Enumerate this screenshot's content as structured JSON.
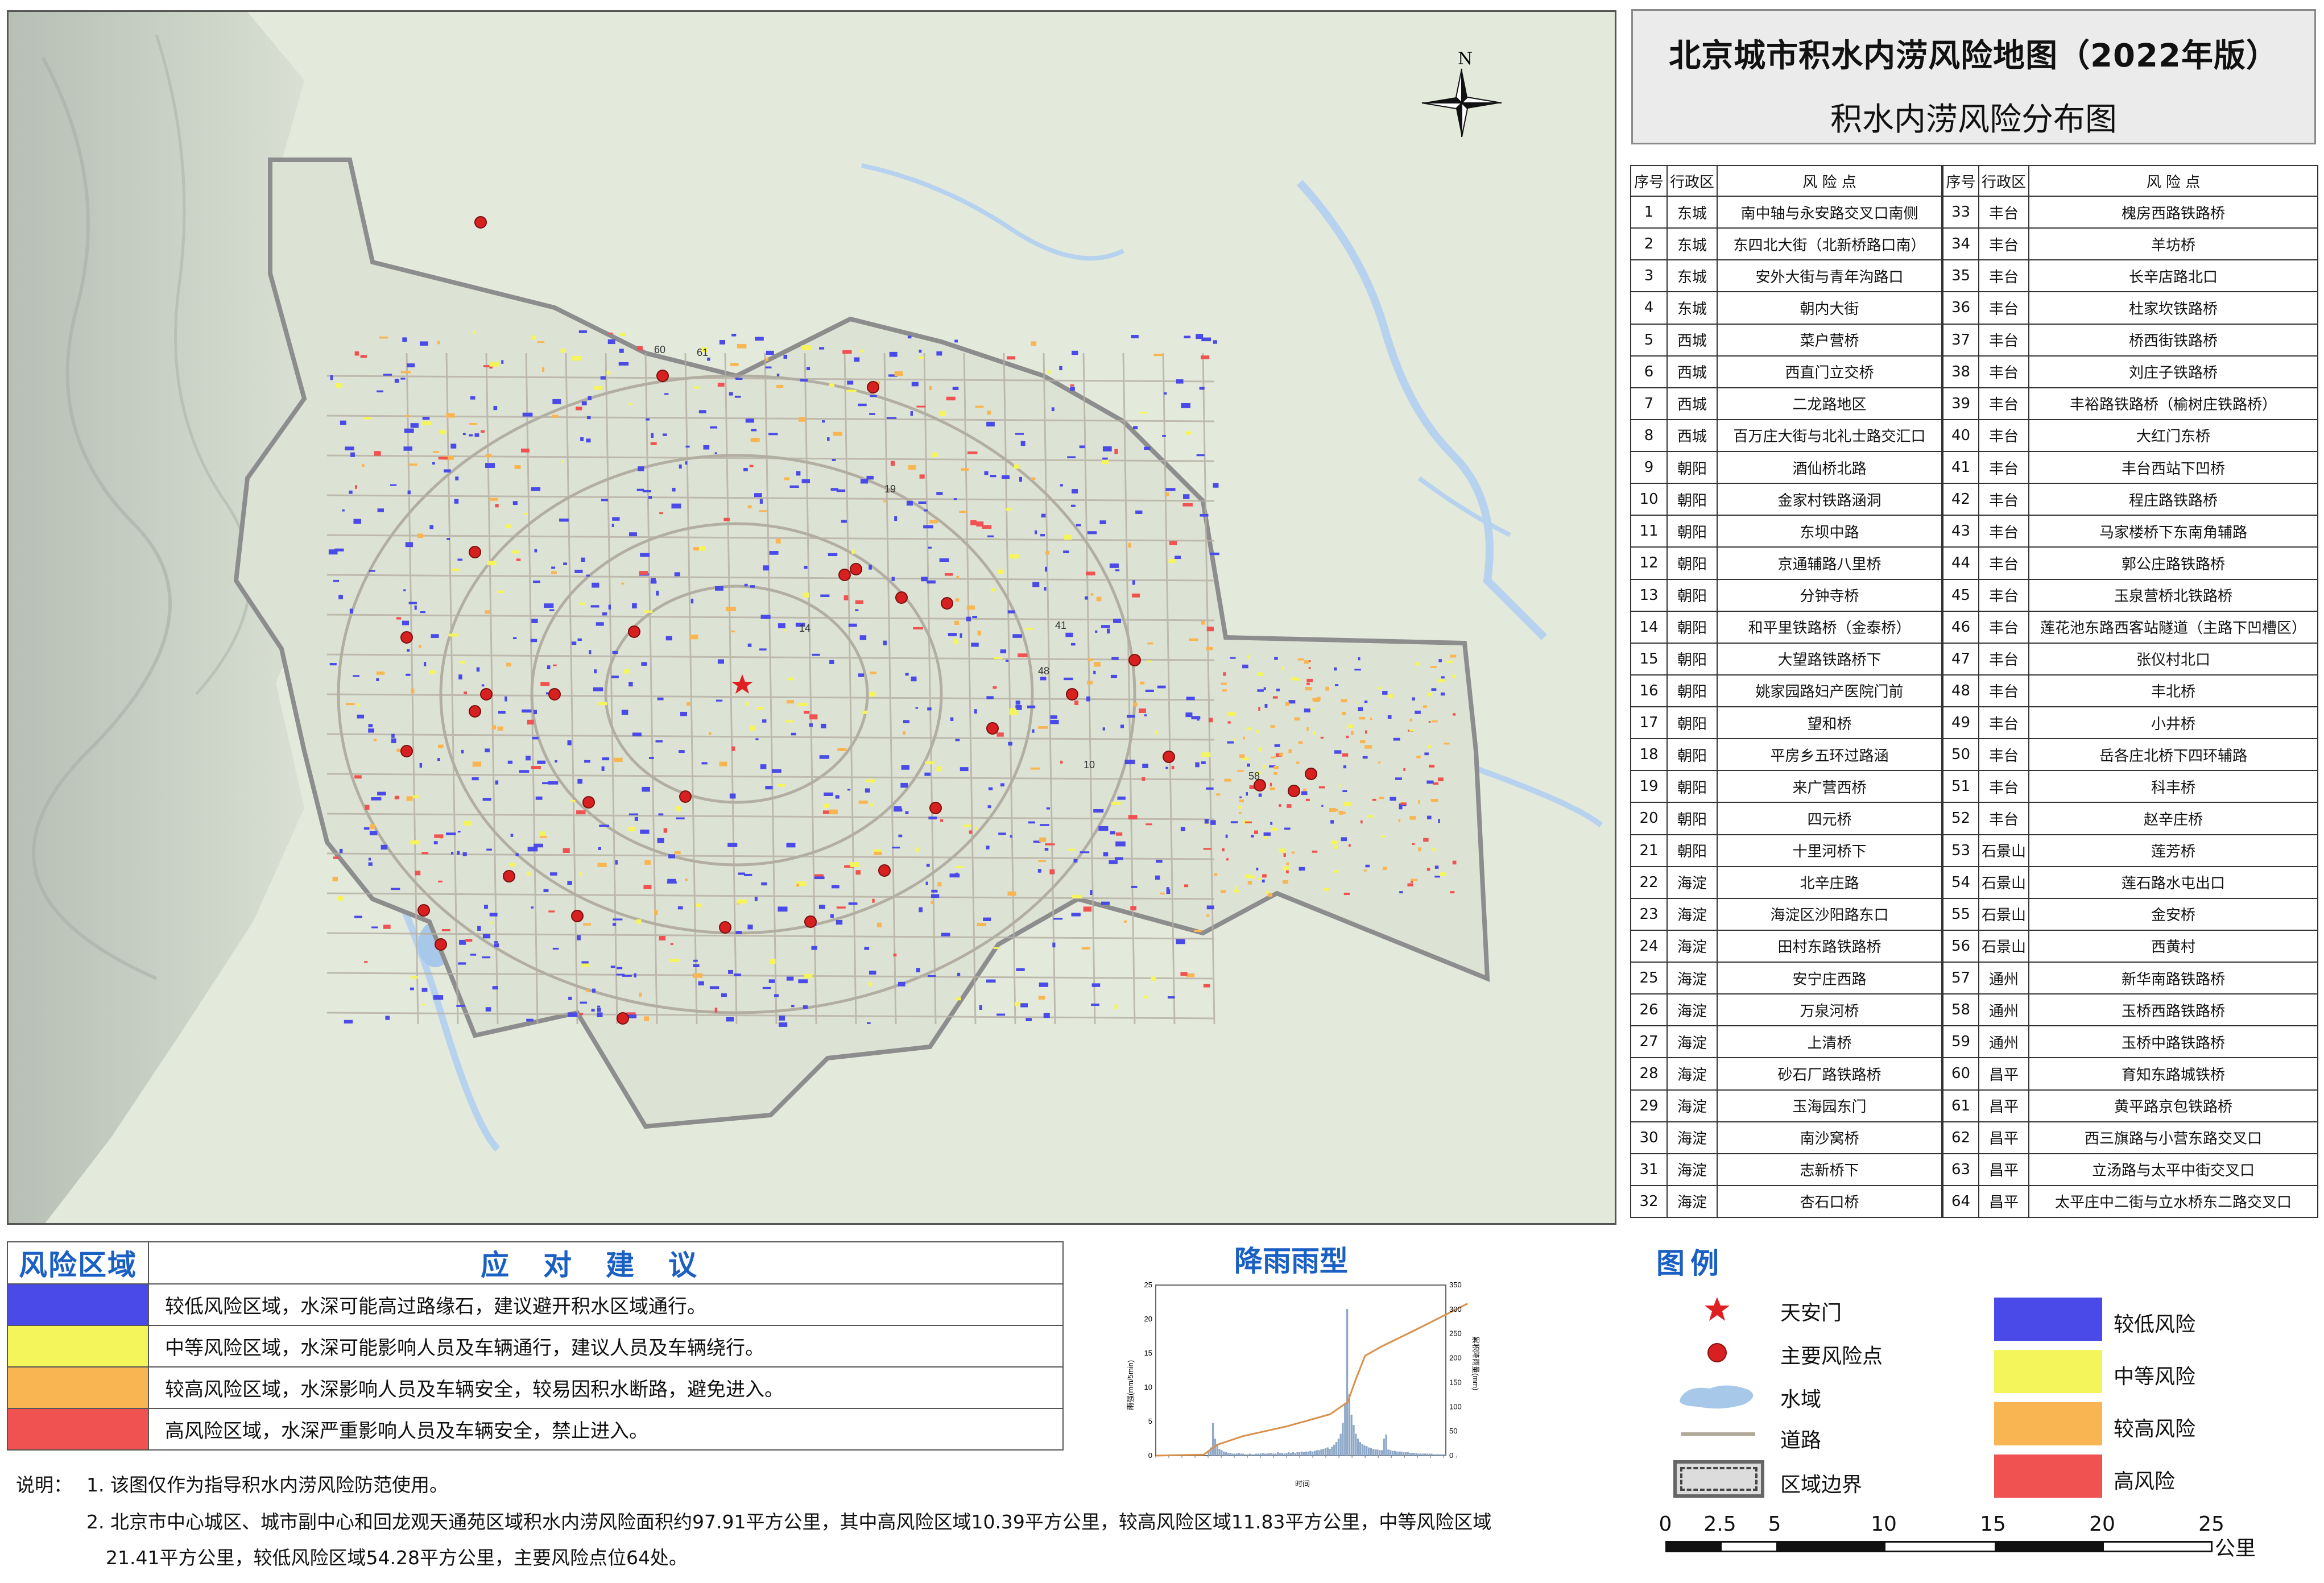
{
  "title": "北京城市积水内涝风险地图（2022年版）",
  "subtitle": "积水内涝风险分布图",
  "compass_label": "N",
  "table": {
    "headers": [
      "序号",
      "行政区",
      "风 险 点",
      "序号",
      "行政区",
      "风 险 点"
    ],
    "rows": [
      [
        "1",
        "东城",
        "南中轴与永安路交叉口南侧",
        "33",
        "丰台",
        "槐房西路铁路桥"
      ],
      [
        "2",
        "东城",
        "东四北大街（北新桥路口南）",
        "34",
        "丰台",
        "羊坊桥"
      ],
      [
        "3",
        "东城",
        "安外大街与青年沟路口",
        "35",
        "丰台",
        "长辛店路北口"
      ],
      [
        "4",
        "东城",
        "朝内大街",
        "36",
        "丰台",
        "杜家坎铁路桥"
      ],
      [
        "5",
        "西城",
        "菜户营桥",
        "37",
        "丰台",
        "桥西街铁路桥"
      ],
      [
        "6",
        "西城",
        "西直门立交桥",
        "38",
        "丰台",
        "刘庄子铁路桥"
      ],
      [
        "7",
        "西城",
        "二龙路地区",
        "39",
        "丰台",
        "丰裕路铁路桥（榆树庄铁路桥）"
      ],
      [
        "8",
        "西城",
        "百万庄大街与北礼士路交汇口",
        "40",
        "丰台",
        "大红门东桥"
      ],
      [
        "9",
        "朝阳",
        "酒仙桥北路",
        "41",
        "丰台",
        "丰台西站下凹桥"
      ],
      [
        "10",
        "朝阳",
        "金家村铁路涵洞",
        "42",
        "丰台",
        "程庄路铁路桥"
      ],
      [
        "11",
        "朝阳",
        "东坝中路",
        "43",
        "丰台",
        "马家楼桥下东南角辅路"
      ],
      [
        "12",
        "朝阳",
        "京通辅路八里桥",
        "44",
        "丰台",
        "郭公庄路铁路桥"
      ],
      [
        "13",
        "朝阳",
        "分钟寺桥",
        "45",
        "丰台",
        "玉泉营桥北铁路桥"
      ],
      [
        "14",
        "朝阳",
        "和平里铁路桥（金泰桥）",
        "46",
        "丰台",
        "莲花池东路西客站隧道（主路下凹槽区）"
      ],
      [
        "15",
        "朝阳",
        "大望路铁路桥下",
        "47",
        "丰台",
        "张仪村北口"
      ],
      [
        "16",
        "朝阳",
        "姚家园路妇产医院门前",
        "48",
        "丰台",
        "丰北桥"
      ],
      [
        "17",
        "朝阳",
        "望和桥",
        "49",
        "丰台",
        "小井桥"
      ],
      [
        "18",
        "朝阳",
        "平房乡五环过路涵",
        "50",
        "丰台",
        "岳各庄北桥下四环辅路"
      ],
      [
        "19",
        "朝阳",
        "来广营西桥",
        "51",
        "丰台",
        "科丰桥"
      ],
      [
        "20",
        "朝阳",
        "四元桥",
        "52",
        "丰台",
        "赵辛庄桥"
      ],
      [
        "21",
        "朝阳",
        "十里河桥下",
        "53",
        "石景山",
        "莲芳桥"
      ],
      [
        "22",
        "海淀",
        "北辛庄路",
        "54",
        "石景山",
        "莲石路水屯出口"
      ],
      [
        "23",
        "海淀",
        "海淀区沙阳路东口",
        "55",
        "石景山",
        "金安桥"
      ],
      [
        "24",
        "海淀",
        "田村东路铁路桥",
        "56",
        "石景山",
        "西黄村"
      ],
      [
        "25",
        "海淀",
        "安宁庄西路",
        "57",
        "通州",
        "新华南路铁路桥"
      ],
      [
        "26",
        "海淀",
        "万泉河桥",
        "58",
        "通州",
        "玉桥西路铁路桥"
      ],
      [
        "27",
        "海淀",
        "上清桥",
        "59",
        "通州",
        "玉桥中路铁路桥"
      ],
      [
        "28",
        "海淀",
        "砂石厂路铁路桥",
        "60",
        "昌平",
        "育知东路城铁桥"
      ],
      [
        "29",
        "海淀",
        "玉海园东门",
        "61",
        "昌平",
        "黄平路京包铁路桥"
      ],
      [
        "30",
        "海淀",
        "南沙窝桥",
        "62",
        "昌平",
        "西三旗路与小营东路交叉口"
      ],
      [
        "31",
        "海淀",
        "志新桥下",
        "63",
        "昌平",
        "立汤路与太平中街交叉口"
      ],
      [
        "32",
        "海淀",
        "杏石口桥",
        "64",
        "昌平",
        "太平庄中二街与立水桥东二路交叉口"
      ]
    ]
  },
  "advice": {
    "header_zone": "风险区域",
    "header_advice": "应对建议",
    "rows": [
      {
        "color": "#4a4ae8",
        "text": "较低风险区域，水深可能高过路缘石，建议避开积水区域通行。"
      },
      {
        "color": "#f4f55a",
        "text": "中等风险区域，水深可能影响人员及车辆通行，建议人员及车辆绕行。"
      },
      {
        "color": "#f9b552",
        "text": "较高风险区域，水深影响人员及车辆安全，较易因积水断路，避免进入。"
      },
      {
        "color": "#f05252",
        "text": "高风险区域，水深严重影响人员及车辆安全，禁止进入。"
      }
    ]
  },
  "rain_chart": {
    "title": "降雨雨型",
    "y_left_ticks": [
      "25",
      "20",
      "15",
      "10",
      "5",
      "0"
    ],
    "y_right_ticks": [
      "350",
      "300",
      "250",
      "200",
      "150",
      "100",
      "50",
      "0"
    ],
    "y_left_label": "雨强(mm/5min)",
    "y_right_label": "累积降雨量(mm)",
    "x_label": "时间"
  },
  "chart_data": {
    "type": "bar",
    "title": "降雨雨型",
    "xlabel": "时间",
    "ylabel": "雨强(mm/5min)",
    "y2label": "累积降雨量(mm)",
    "ylim": [
      0,
      25
    ],
    "y2lim": [
      0,
      350
    ],
    "x_range": [
      "00:00",
      "23:55"
    ],
    "series": [
      {
        "name": "雨强(mm/5min)",
        "type": "bar",
        "values": [
          0,
          0,
          0,
          0,
          0,
          0,
          0,
          0,
          0,
          0,
          0,
          0,
          0,
          0,
          0,
          0,
          0,
          0,
          0,
          0,
          0,
          0,
          0,
          0,
          0.6,
          1.2,
          4.8,
          2.5,
          1.5,
          1.0,
          0.8,
          0.6,
          0.5,
          0.4,
          0.4,
          0.3,
          0.3,
          0.3,
          0.4,
          0.3,
          0.3,
          0.2,
          0.2,
          0.3,
          0.2,
          0.2,
          0.3,
          0.3,
          0.3,
          0.4,
          0.3,
          0.3,
          0.4,
          0.4,
          0.3,
          0.3,
          0.5,
          0.4,
          0.4,
          0.3,
          0.4,
          0.5,
          0.4,
          0.5,
          0.4,
          0.5,
          0.5,
          0.6,
          0.5,
          0.6,
          0.6,
          0.7,
          0.6,
          0.7,
          0.8,
          0.8,
          0.9,
          1.0,
          1.1,
          1.2,
          1.0,
          1.3,
          1.6,
          2.0,
          2.5,
          3.2,
          4.8,
          7.5,
          21.5,
          9.0,
          6.0,
          4.5,
          3.2,
          2.5,
          2.0,
          1.7,
          1.5,
          1.4,
          1.2,
          1.1,
          1.0,
          0.9,
          0.9,
          0.8,
          0.8,
          2.5,
          3.1,
          0.9,
          0.8,
          0.7,
          0.7,
          0.6,
          0.6,
          0.6,
          0.5,
          0.5,
          0.5,
          0.4,
          0.4,
          0.4,
          0.4,
          0.3,
          0.3,
          0.3,
          0.3,
          0.3,
          0.3,
          0.3,
          0.2,
          0.2,
          0.2,
          0.2,
          0.2,
          0.2
        ]
      },
      {
        "name": "累积降雨量(mm)",
        "type": "line",
        "points": [
          [
            0,
            0
          ],
          [
            22,
            2
          ],
          [
            28,
            22
          ],
          [
            40,
            40
          ],
          [
            60,
            60
          ],
          [
            80,
            85
          ],
          [
            88,
            110
          ],
          [
            92,
            160
          ],
          [
            96,
            205
          ],
          [
            104,
            225
          ],
          [
            120,
            260
          ],
          [
            143,
            312
          ]
        ]
      }
    ]
  },
  "notes": {
    "label": "说明：",
    "items": [
      "1. 该图仅作为指导积水内涝风险防范使用。",
      "2. 北京市中心城区、城市副中心和回龙观天通苑区域积水内涝风险面积约97.91平方公里，其中高风险区域10.39平方公里，较高风险区域11.83平方公里，中等风险区域",
      "21.41平方公里，较低风险区域54.28平方公里，主要风险点位64处。"
    ]
  },
  "legend": {
    "title": "图例",
    "items_left": [
      {
        "icon": "star-icon",
        "label": "天安门",
        "color": "#e02020"
      },
      {
        "icon": "risk-point-icon",
        "label": "主要风险点",
        "color": "#d82020"
      },
      {
        "icon": "water-icon",
        "label": "水域",
        "color": "#a8c8ea"
      },
      {
        "icon": "road-icon",
        "label": "道路",
        "color": "#b0a898"
      },
      {
        "icon": "boundary-icon",
        "label": "区域边界",
        "color": "#777777"
      }
    ],
    "items_right": [
      {
        "label": "较低风险",
        "color": "#4a4ae8"
      },
      {
        "label": "中等风险",
        "color": "#f4f55a"
      },
      {
        "label": "较高风险",
        "color": "#f9b552"
      },
      {
        "label": "高风险",
        "color": "#f05252"
      }
    ]
  },
  "scale_bar": {
    "ticks": [
      "0",
      "2.5",
      "5",
      "10",
      "15",
      "20",
      "25"
    ],
    "unit": "公里"
  },
  "map_point_labels": [
    "60",
    "61",
    "19",
    "14",
    "41",
    "48",
    "10",
    "58"
  ]
}
